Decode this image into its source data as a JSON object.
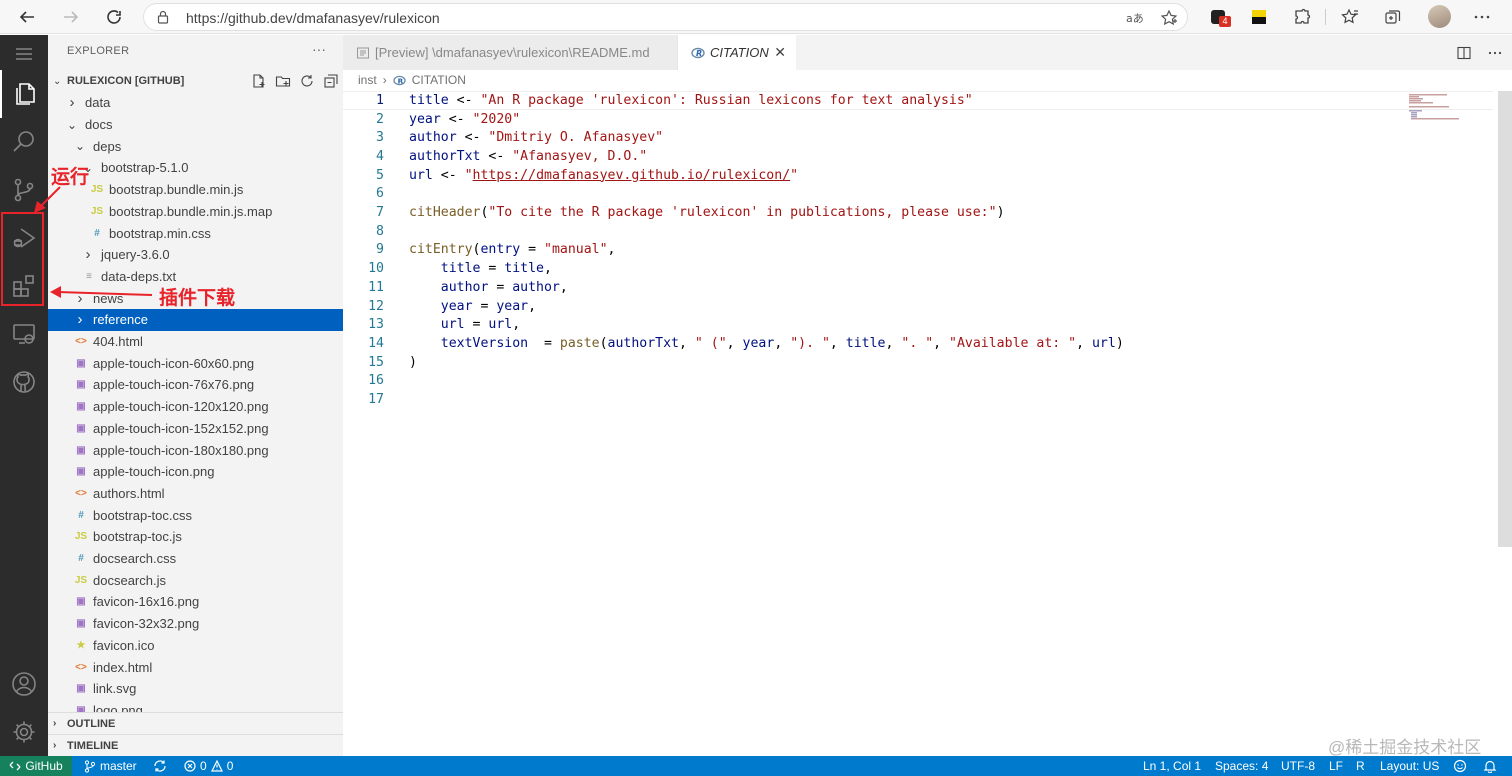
{
  "browser": {
    "url": "https://github.dev/dmafanasyev/rulexicon",
    "extension_badge": "4"
  },
  "explorer": {
    "title": "EXPLORER",
    "more": "···",
    "root_label": "RULEXICON [GITHUB]",
    "items": [
      {
        "label": "data",
        "type": "folder",
        "state": "collapsed",
        "depth": 1
      },
      {
        "label": "docs",
        "type": "folder",
        "state": "expanded",
        "depth": 1
      },
      {
        "label": "deps",
        "type": "folder",
        "state": "expanded",
        "depth": 2
      },
      {
        "label": "bootstrap-5.1.0",
        "type": "folder",
        "state": "expanded",
        "depth": 3
      },
      {
        "label": "bootstrap.bundle.min.js",
        "type": "js",
        "depth": 4
      },
      {
        "label": "bootstrap.bundle.min.js.map",
        "type": "js",
        "depth": 4
      },
      {
        "label": "bootstrap.min.css",
        "type": "css",
        "depth": 4
      },
      {
        "label": "jquery-3.6.0",
        "type": "folder",
        "state": "collapsed",
        "depth": 3
      },
      {
        "label": "data-deps.txt",
        "type": "txt",
        "depth": 3
      },
      {
        "label": "news",
        "type": "folder",
        "state": "collapsed",
        "depth": 2
      },
      {
        "label": "reference",
        "type": "folder",
        "state": "collapsed",
        "depth": 2,
        "selected": true
      },
      {
        "label": "404.html",
        "type": "html",
        "depth": 2
      },
      {
        "label": "apple-touch-icon-60x60.png",
        "type": "img",
        "depth": 2
      },
      {
        "label": "apple-touch-icon-76x76.png",
        "type": "img",
        "depth": 2
      },
      {
        "label": "apple-touch-icon-120x120.png",
        "type": "img",
        "depth": 2
      },
      {
        "label": "apple-touch-icon-152x152.png",
        "type": "img",
        "depth": 2
      },
      {
        "label": "apple-touch-icon-180x180.png",
        "type": "img",
        "depth": 2
      },
      {
        "label": "apple-touch-icon.png",
        "type": "img",
        "depth": 2
      },
      {
        "label": "authors.html",
        "type": "html",
        "depth": 2
      },
      {
        "label": "bootstrap-toc.css",
        "type": "css",
        "depth": 2
      },
      {
        "label": "bootstrap-toc.js",
        "type": "js",
        "depth": 2
      },
      {
        "label": "docsearch.css",
        "type": "css",
        "depth": 2
      },
      {
        "label": "docsearch.js",
        "type": "js",
        "depth": 2
      },
      {
        "label": "favicon-16x16.png",
        "type": "img",
        "depth": 2
      },
      {
        "label": "favicon-32x32.png",
        "type": "img",
        "depth": 2
      },
      {
        "label": "favicon.ico",
        "type": "ico",
        "depth": 2
      },
      {
        "label": "index.html",
        "type": "html",
        "depth": 2
      },
      {
        "label": "link.svg",
        "type": "svg",
        "depth": 2
      },
      {
        "label": "logo.png",
        "type": "img",
        "depth": 2
      }
    ],
    "outline_label": "OUTLINE",
    "timeline_label": "TIMELINE"
  },
  "editor": {
    "tabs": [
      {
        "label": "[Preview] \\dmafanasyev\\rulexicon\\README.md",
        "active": false
      },
      {
        "label": "CITATION",
        "active": true
      }
    ],
    "breadcrumb": [
      "inst",
      "CITATION"
    ],
    "lines": [
      [
        {
          "t": "title ",
          "c": "v"
        },
        {
          "t": "<- ",
          "c": "op"
        },
        {
          "t": "\"An R package 'rulexicon': Russian lexicons for text analysis\"",
          "c": "str"
        }
      ],
      [
        {
          "t": "year ",
          "c": "v"
        },
        {
          "t": "<- ",
          "c": "op"
        },
        {
          "t": "\"2020\"",
          "c": "str"
        }
      ],
      [
        {
          "t": "author ",
          "c": "v"
        },
        {
          "t": "<- ",
          "c": "op"
        },
        {
          "t": "\"Dmitriy O. Afanasyev\"",
          "c": "str"
        }
      ],
      [
        {
          "t": "authorTxt ",
          "c": "v"
        },
        {
          "t": "<- ",
          "c": "op"
        },
        {
          "t": "\"Afanasyev, D.O.\"",
          "c": "str"
        }
      ],
      [
        {
          "t": "url ",
          "c": "v"
        },
        {
          "t": "<- ",
          "c": "op"
        },
        {
          "t": "\"",
          "c": "str"
        },
        {
          "t": "https://dmafanasyev.github.io/rulexicon/",
          "c": "link"
        },
        {
          "t": "\"",
          "c": "str"
        }
      ],
      [],
      [
        {
          "t": "citHeader",
          "c": "fn"
        },
        {
          "t": "(",
          "c": "op"
        },
        {
          "t": "\"To cite the R package 'rulexicon' in publications, please use:\"",
          "c": "str"
        },
        {
          "t": ")",
          "c": "op"
        }
      ],
      [],
      [
        {
          "t": "citEntry",
          "c": "fn"
        },
        {
          "t": "(",
          "c": "op"
        },
        {
          "t": "entry ",
          "c": "v"
        },
        {
          "t": "= ",
          "c": "op"
        },
        {
          "t": "\"manual\"",
          "c": "str"
        },
        {
          "t": ",",
          "c": "op"
        }
      ],
      [
        {
          "t": "    title ",
          "c": "v"
        },
        {
          "t": "= ",
          "c": "op"
        },
        {
          "t": "title",
          "c": "v"
        },
        {
          "t": ",",
          "c": "op"
        }
      ],
      [
        {
          "t": "    author ",
          "c": "v"
        },
        {
          "t": "= ",
          "c": "op"
        },
        {
          "t": "author",
          "c": "v"
        },
        {
          "t": ",",
          "c": "op"
        }
      ],
      [
        {
          "t": "    year ",
          "c": "v"
        },
        {
          "t": "= ",
          "c": "op"
        },
        {
          "t": "year",
          "c": "v"
        },
        {
          "t": ",",
          "c": "op"
        }
      ],
      [
        {
          "t": "    url ",
          "c": "v"
        },
        {
          "t": "= ",
          "c": "op"
        },
        {
          "t": "url",
          "c": "v"
        },
        {
          "t": ",",
          "c": "op"
        }
      ],
      [
        {
          "t": "    textVersion  ",
          "c": "v"
        },
        {
          "t": "= ",
          "c": "op"
        },
        {
          "t": "paste",
          "c": "fn"
        },
        {
          "t": "(",
          "c": "op"
        },
        {
          "t": "authorTxt",
          "c": "v"
        },
        {
          "t": ", ",
          "c": "op"
        },
        {
          "t": "\" (\"",
          "c": "str"
        },
        {
          "t": ", ",
          "c": "op"
        },
        {
          "t": "year",
          "c": "v"
        },
        {
          "t": ", ",
          "c": "op"
        },
        {
          "t": "\"). \"",
          "c": "str"
        },
        {
          "t": ", ",
          "c": "op"
        },
        {
          "t": "title",
          "c": "v"
        },
        {
          "t": ", ",
          "c": "op"
        },
        {
          "t": "\". \"",
          "c": "str"
        },
        {
          "t": ", ",
          "c": "op"
        },
        {
          "t": "\"Available at: \"",
          "c": "str"
        },
        {
          "t": ", ",
          "c": "op"
        },
        {
          "t": "url",
          "c": "v"
        },
        {
          "t": ")",
          "c": "op"
        }
      ],
      [
        {
          "t": ")",
          "c": "op"
        }
      ],
      [],
      []
    ]
  },
  "annotations": {
    "run_label": "运行",
    "extensions_label": "插件下载"
  },
  "statusbar": {
    "remote": "GitHub",
    "branch": "master",
    "errors": "0",
    "warnings": "0",
    "position": "Ln 1, Col 1",
    "spaces": "Spaces: 4",
    "encoding": "UTF-8",
    "eol": "LF",
    "language": "R",
    "layout": "Layout: US"
  },
  "watermark": "@稀土掘金技术社区",
  "colors": {
    "accent": "#007acc",
    "selection": "#0060c0",
    "annotation": "#e8232a",
    "remote": "#16825d"
  }
}
